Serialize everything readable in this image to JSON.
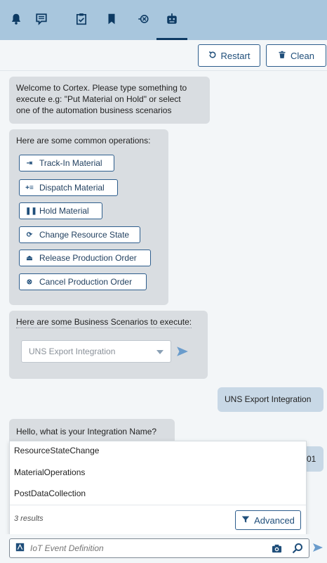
{
  "tabs": [
    {
      "icon": "bell-icon"
    },
    {
      "icon": "message-icon"
    },
    {
      "icon": "clipboard-check-icon"
    },
    {
      "icon": "bookmark-icon"
    },
    {
      "icon": "flow-cancel-icon"
    },
    {
      "icon": "robot-icon",
      "active": true
    }
  ],
  "toolbar": {
    "restart_label": "Restart",
    "clean_label": "Clean"
  },
  "welcome": {
    "line1": "Welcome to Cortex. Please type something to",
    "line2": "execute e.g: \"Put Material on Hold\" or select",
    "line3": "one of the automation business scenarios"
  },
  "operations": {
    "title": "Here are some common operations:",
    "items": [
      {
        "label": "Track-In Material",
        "icon": "track-in-icon"
      },
      {
        "label": "Dispatch Material",
        "icon": "dispatch-icon"
      },
      {
        "label": "Hold Material",
        "icon": "pause-icon"
      },
      {
        "label": "Change Resource State",
        "icon": "cycle-icon"
      },
      {
        "label": "Release Production Order",
        "icon": "eject-icon"
      },
      {
        "label": "Cancel Production Order",
        "icon": "cancel-circle-icon"
      }
    ]
  },
  "scenarios": {
    "title": "Here are some Business Scenarios to execute:",
    "selected": "UNS Export Integration"
  },
  "user_message": "UNS Export Integration",
  "question": "Hello, what is your Integration Name?",
  "partial_bubble_text": "01",
  "dropdown": {
    "items": [
      "ResourceStateChange",
      "MaterialOperations",
      "PostDataCollection"
    ],
    "results": "3 results",
    "advanced_label": "Advanced"
  },
  "composer": {
    "placeholder": "IoT Event Definition"
  },
  "colors": {
    "topbar": "#a8c6dd",
    "accent": "#1f4e7a",
    "bubble": "#d9dde1",
    "user_bubble": "#c8d8e6"
  }
}
